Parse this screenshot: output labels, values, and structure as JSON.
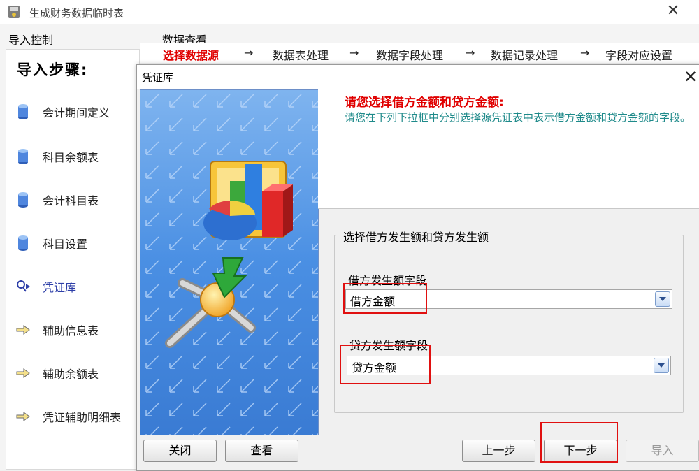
{
  "window": {
    "title": "生成财务数据临时表",
    "close_glyph": "✕"
  },
  "panels": {
    "import_control": "导入控制",
    "data_view": "数据查看"
  },
  "steps": {
    "heading": "导入步骤:",
    "items": [
      {
        "label": "会计期间定义",
        "icon": "cylinder-icon"
      },
      {
        "label": "科目余额表",
        "icon": "cylinder-icon"
      },
      {
        "label": "会计科目表",
        "icon": "cylinder-icon"
      },
      {
        "label": "科目设置",
        "icon": "cylinder-icon"
      },
      {
        "label": "凭证库",
        "icon": "search-arrow-icon",
        "active": true
      },
      {
        "label": "辅助信息表",
        "icon": "pointing-hand-icon"
      },
      {
        "label": "辅助余额表",
        "icon": "pointing-hand-icon"
      },
      {
        "label": "凭证辅助明细表",
        "icon": "pointing-hand-icon"
      }
    ]
  },
  "flow": {
    "items": [
      "选择数据源",
      "数据表处理",
      "数据字段处理",
      "数据记录处理",
      "字段对应设置"
    ],
    "current": 0,
    "arrow": "→"
  },
  "dialog": {
    "title": "凭证库",
    "close_glyph": "✕",
    "instruction_title": "请您选择借方金额和贷方金额:",
    "instruction_text": "请您在下列下拉框中分别选择源凭证表中表示借方金额和贷方金额的字段。",
    "group_title": "选择借方发生额和贷方发生额",
    "debit_label": "借方发生额字段",
    "debit_value": "借方金额",
    "credit_label": "贷方发生额字段",
    "credit_value": "贷方金额",
    "buttons": {
      "close": "关闭",
      "view": "查看",
      "prev": "上一步",
      "next": "下一步",
      "import": "导入"
    }
  },
  "colors": {
    "accent_red": "#e00000",
    "highlight_red": "#e01010",
    "info_teal": "#1e8a8a",
    "active_step": "#2e3fa8",
    "art_blue": "#3f7fd6"
  }
}
